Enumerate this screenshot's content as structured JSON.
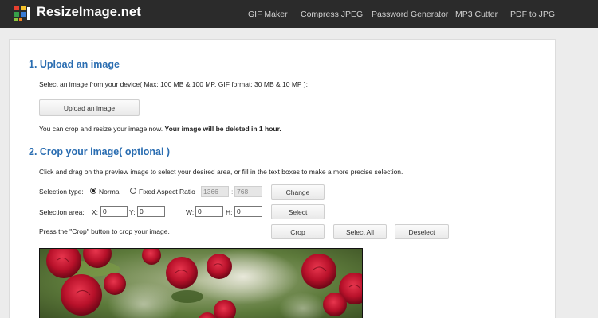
{
  "header": {
    "brand": "ResizeImage.net",
    "nav": [
      "GIF Maker",
      "Compress JPEG",
      "Password Generator",
      "MP3 Cutter",
      "PDF to JPG"
    ]
  },
  "upload": {
    "heading": "1. Upload an image",
    "instruction": "Select an image from your device( Max: 100 MB & 100 MP, GIF format: 30 MB & 10 MP ):",
    "button_label": "Upload an image",
    "notice_prefix": "You can crop and resize your image now.",
    "notice_bold": "Your image will be deleted in 1 hour."
  },
  "crop": {
    "heading": "2. Crop your image( optional )",
    "instruction": "Click and drag on the preview image to select your desired area, or fill in the text boxes to make a more precise selection.",
    "selection_type_label": "Selection type:",
    "option_normal": "Normal",
    "option_fixed": "Fixed Aspect Ratio",
    "selected_type": "Normal",
    "ratio_width": "1366",
    "ratio_sep": ":",
    "ratio_height": "768",
    "change_button": "Change",
    "selection_area_label": "Selection area:",
    "x_label": "X:",
    "x_value": "0",
    "y_label": "Y:",
    "y_value": "0",
    "w_label": "W:",
    "w_value": "0",
    "h_label": "H:",
    "h_value": "0",
    "select_button": "Select",
    "press_text": "Press the \"Crop\" button to crop your image.",
    "crop_button": "Crop",
    "select_all_button": "Select All",
    "deselect_button": "Deselect"
  },
  "colors": {
    "header_bg": "#2b2b2b",
    "heading_blue": "#2a6db1",
    "rose_red": "#c0152e"
  },
  "preview": {
    "icon": "roses-photo"
  }
}
